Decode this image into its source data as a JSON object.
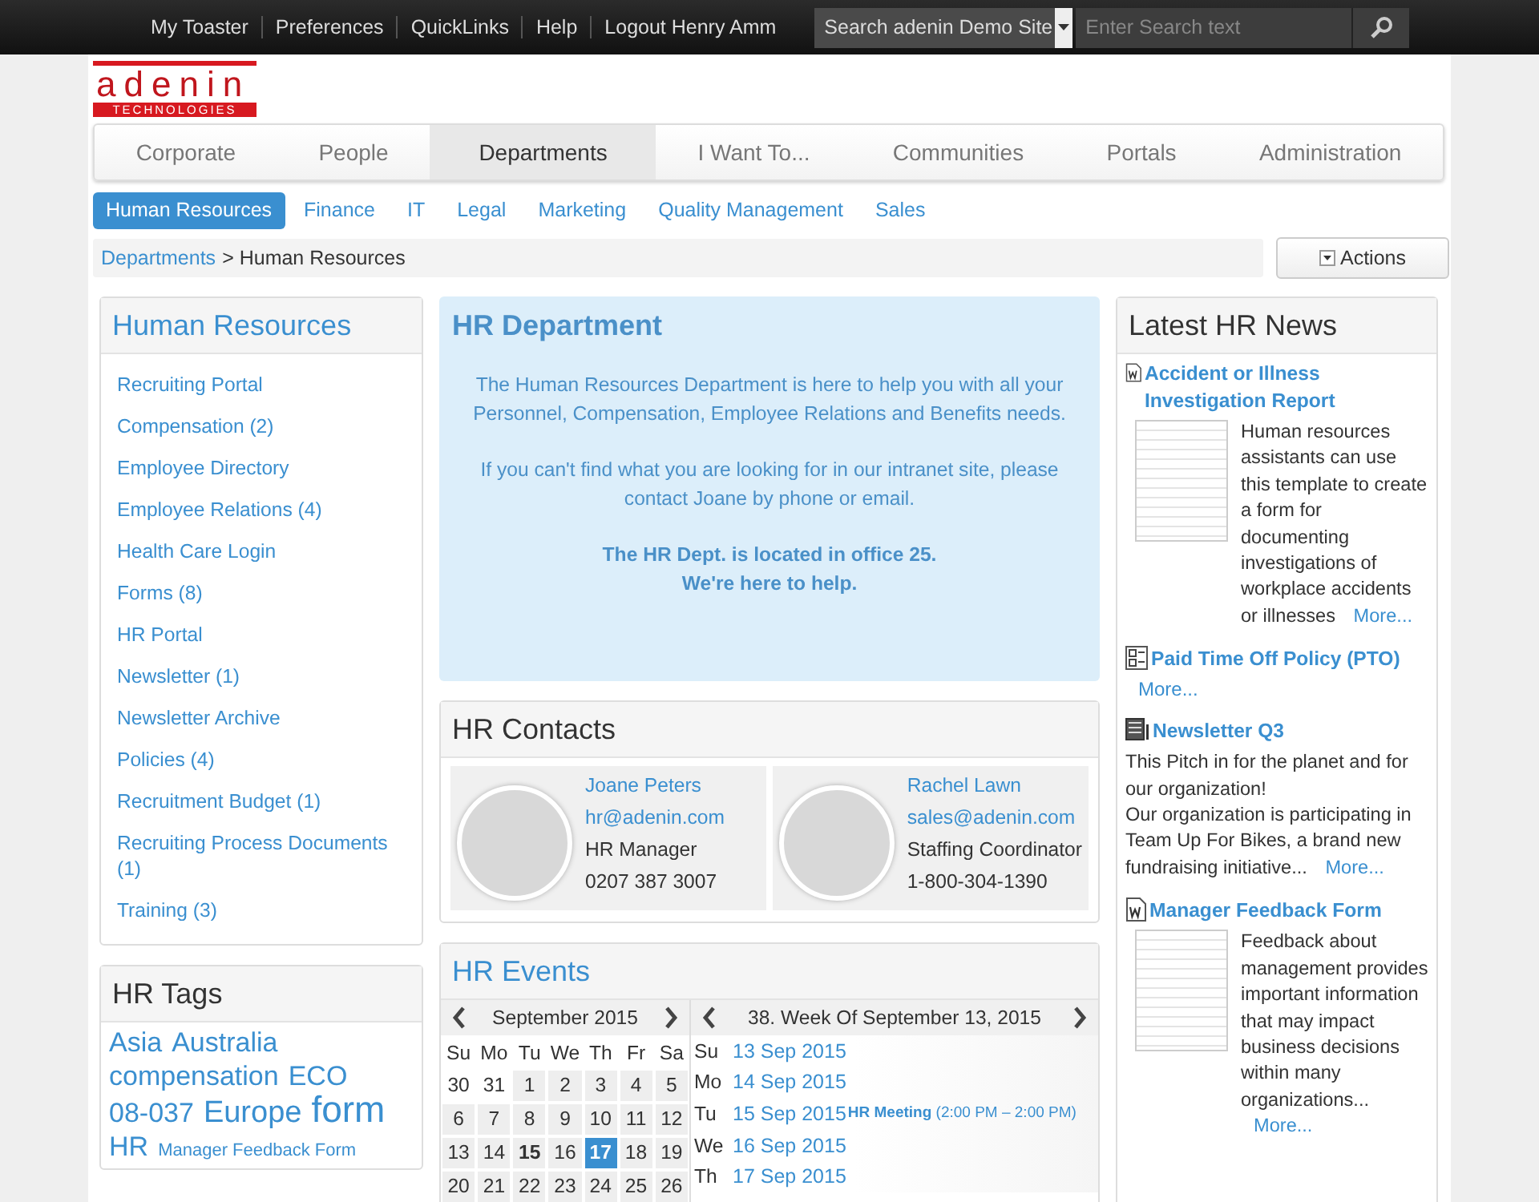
{
  "top_bar": {
    "links": [
      "My Toaster",
      "Preferences",
      "QuickLinks",
      "Help",
      "Logout Henry Amm"
    ],
    "search": {
      "scope": "Search adenin Demo Site",
      "placeholder": "Enter Search text"
    }
  },
  "logo": {
    "name": "adenin",
    "tagline": "TECHNOLOGIES"
  },
  "main_nav": [
    {
      "label": "Corporate",
      "selected": false
    },
    {
      "label": "People",
      "selected": false
    },
    {
      "label": "Departments",
      "selected": true
    },
    {
      "label": "I Want To...",
      "selected": false
    },
    {
      "label": "Communities",
      "selected": false
    },
    {
      "label": "Portals",
      "selected": false
    },
    {
      "label": "Administration",
      "selected": false
    }
  ],
  "sub_nav": [
    {
      "label": "Human Resources",
      "selected": true
    },
    {
      "label": "Finance",
      "selected": false
    },
    {
      "label": "IT",
      "selected": false
    },
    {
      "label": "Legal",
      "selected": false
    },
    {
      "label": "Marketing",
      "selected": false
    },
    {
      "label": "Quality Management",
      "selected": false
    },
    {
      "label": "Sales",
      "selected": false
    }
  ],
  "breadcrumb": {
    "link": "Departments",
    "current": "> Human Resources"
  },
  "actions_button": "Actions",
  "sidebar": {
    "title": "Human Resources",
    "items": [
      "Recruiting Portal",
      "Compensation (2)",
      "Employee Directory",
      "Employee Relations (4)",
      "Health Care Login",
      "Forms (8)",
      "HR Portal",
      "Newsletter (1)",
      "Newsletter Archive",
      "Policies (4)",
      "Recruitment Budget (1)",
      "Recruiting Process Documents (1)",
      "Training (3)"
    ]
  },
  "tags": {
    "title": "HR Tags",
    "items": [
      {
        "label": "Asia",
        "kind": "medium"
      },
      {
        "label": "Australia",
        "kind": "medium"
      },
      {
        "label": "compensation",
        "kind": "medium"
      },
      {
        "label": "ECO",
        "kind": "medium"
      },
      {
        "label": "08-037",
        "kind": "medium"
      },
      {
        "label": "Europe",
        "kind": "large"
      },
      {
        "label": "form",
        "kind": "xlarge"
      },
      {
        "label": "HR",
        "kind": "medium"
      },
      {
        "label": "Manager Feedback Form",
        "kind": "small"
      }
    ]
  },
  "department": {
    "title": "HR Department",
    "paragraphs": [
      {
        "text": "The Human Resources Department is here to help you with all your Personnel, Compensation, Employee Relations and Benefits needs.",
        "kind": "normal"
      },
      {
        "text": "If you can't find what you are looking for in our intranet site, please contact Joane by phone or email.",
        "kind": "normal"
      },
      {
        "text": "The HR Dept. is located in office 25.\nWe're here to help.",
        "kind": "bold"
      }
    ]
  },
  "contacts": {
    "title": "HR Contacts",
    "people": [
      {
        "name": "Joane Peters",
        "email": "hr@adenin.com",
        "role": "HR Manager",
        "phone": "0207 387 3007"
      },
      {
        "name": "Rachel Lawn",
        "email": "sales@adenin.com",
        "role": "Staffing Coordinator",
        "phone": "1-800-304-1390"
      }
    ]
  },
  "events": {
    "title": "HR Events",
    "month": "September 2015",
    "weekdays": [
      "Su",
      "Mo",
      "Tu",
      "We",
      "Th",
      "Fr",
      "Sa"
    ],
    "days": [
      {
        "label": "30",
        "kind": "other",
        "selected": false
      },
      {
        "label": "31",
        "kind": "other",
        "selected": false
      },
      {
        "label": "1",
        "kind": "day",
        "selected": false
      },
      {
        "label": "2",
        "kind": "day",
        "selected": false
      },
      {
        "label": "3",
        "kind": "day",
        "selected": false
      },
      {
        "label": "4",
        "kind": "day",
        "selected": false
      },
      {
        "label": "5",
        "kind": "day",
        "selected": false
      },
      {
        "label": "6",
        "kind": "day",
        "selected": false
      },
      {
        "label": "7",
        "kind": "day",
        "selected": false
      },
      {
        "label": "8",
        "kind": "day",
        "selected": false
      },
      {
        "label": "9",
        "kind": "day",
        "selected": false
      },
      {
        "label": "10",
        "kind": "day",
        "selected": false
      },
      {
        "label": "11",
        "kind": "day",
        "selected": false
      },
      {
        "label": "12",
        "kind": "day",
        "selected": false
      },
      {
        "label": "13",
        "kind": "day",
        "selected": false
      },
      {
        "label": "14",
        "kind": "day",
        "selected": false
      },
      {
        "label": "15",
        "kind": "today",
        "selected": false
      },
      {
        "label": "16",
        "kind": "day",
        "selected": false
      },
      {
        "label": "17",
        "kind": "day",
        "selected": true
      },
      {
        "label": "18",
        "kind": "day",
        "selected": false
      },
      {
        "label": "19",
        "kind": "day",
        "selected": false
      },
      {
        "label": "20",
        "kind": "day",
        "selected": false
      },
      {
        "label": "21",
        "kind": "day",
        "selected": false
      },
      {
        "label": "22",
        "kind": "day",
        "selected": false
      },
      {
        "label": "23",
        "kind": "day",
        "selected": false
      },
      {
        "label": "24",
        "kind": "day",
        "selected": false
      },
      {
        "label": "25",
        "kind": "day",
        "selected": false
      },
      {
        "label": "26",
        "kind": "day",
        "selected": false
      }
    ],
    "week_title": "38. Week Of September 13, 2015",
    "week": [
      {
        "day": "Su",
        "date": "13 Sep 2015"
      },
      {
        "day": "Mo",
        "date": "14 Sep 2015"
      },
      {
        "day": "Tu",
        "date": "15 Sep 2015",
        "event": {
          "title": "HR Meeting",
          "time": "(2:00 PM – 2:00 PM)"
        }
      },
      {
        "day": "We",
        "date": "16 Sep 2015"
      },
      {
        "day": "Th",
        "date": "17 Sep 2015"
      }
    ]
  },
  "news": {
    "title": "Latest HR News",
    "items": [
      {
        "kind": "document",
        "title": "Accident or Illness Investigation Report",
        "thumbnail": true,
        "text": "Human resources assistants can use this template to create a form for documenting investigations of workplace accidents or illnesses",
        "more": "More..."
      },
      {
        "kind": "form",
        "title": "Paid Time Off Policy (PTO)",
        "thumbnail": false,
        "more": "More..."
      },
      {
        "kind": "newsletter",
        "title": "Newsletter Q3",
        "thumbnail": false,
        "text": "This Pitch in for the planet and for our organization!\nOur organization is participating in Team Up For Bikes, a brand new fundraising initiative...",
        "more": "More..."
      },
      {
        "kind": "document",
        "title": "Manager Feedback Form",
        "thumbnail": true,
        "text": "Feedback about management provides important information that may impact business decisions within many organizations...",
        "more": "More..."
      }
    ]
  }
}
